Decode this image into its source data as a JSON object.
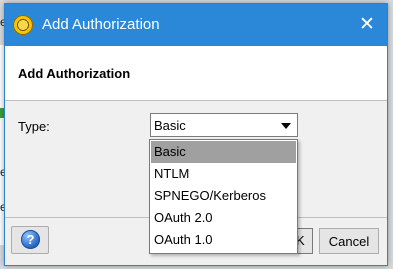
{
  "background": {
    "fragment_chars": [
      "e",
      "e",
      "e"
    ]
  },
  "dialog": {
    "title": "Add Authorization",
    "close_glyph": "✕",
    "header_title": "Add Authorization",
    "type_label": "Type:",
    "type_select": {
      "value": "Basic",
      "options": [
        "Basic",
        "NTLM",
        "SPNEGO/Kerberos",
        "OAuth 2.0",
        "OAuth 1.0"
      ],
      "highlighted_index": 0
    },
    "buttons": {
      "help_glyph": "?",
      "ok_partial_label": "K",
      "cancel_label": "Cancel"
    }
  },
  "colors": {
    "titlebar": "#2b88d8",
    "selection_highlight": "#a0a0a0",
    "dialog_body": "#f0f0f0"
  },
  "icons": {
    "app": "soapui-logo-icon",
    "help": "question-circle-icon",
    "close": "close-icon",
    "dropdown": "chevron-down-icon"
  }
}
